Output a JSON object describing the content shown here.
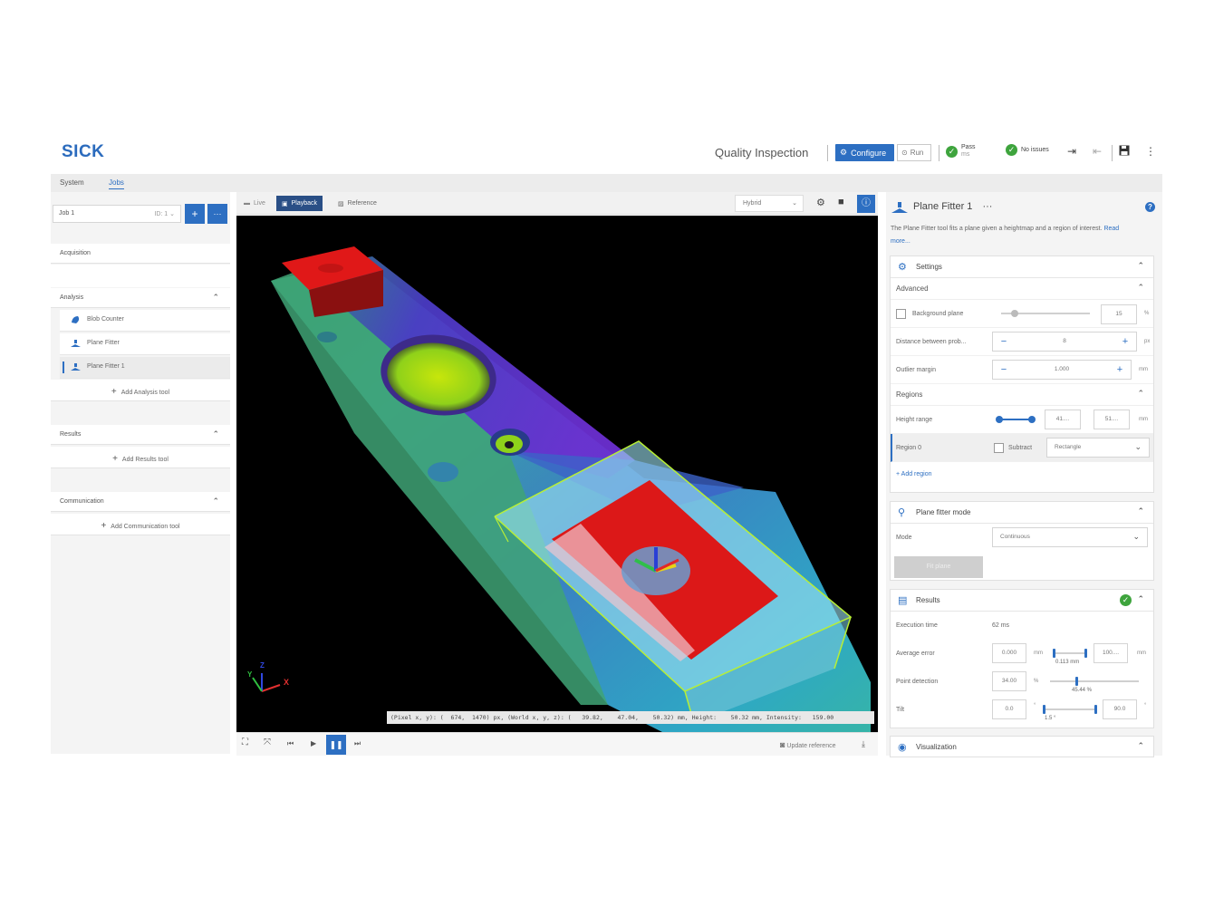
{
  "header": {
    "logo": "SICK",
    "title": "Quality Inspection",
    "configure_label": "Configure",
    "run_label": "Run",
    "pass_label": "Pass",
    "pass_sub": "ms",
    "issues_label": "No issues"
  },
  "nav": {
    "tabs": [
      "System",
      "Jobs"
    ],
    "active": "Jobs"
  },
  "left": {
    "job_value": "Job 1",
    "job_id": "ID: 1",
    "add_label": "+",
    "more_label": "···",
    "sections": {
      "acquisition": "Acquisition",
      "analysis": "Analysis",
      "results": "Results",
      "communication": "Communication"
    },
    "analysis_tools": [
      "Blob Counter",
      "Plane Fitter",
      "Plane Fitter 1"
    ],
    "add_analysis": "Add Analysis tool",
    "add_results": "Add Results tool",
    "add_communication": "Add Communication tool"
  },
  "viewer": {
    "tabs": {
      "live": "Live",
      "playback": "Playback",
      "reference": "Reference"
    },
    "mode_select": "Hybrid",
    "coords": "(Pixel x, y): (  674,  1470) px, (World x, y, z): (   39.82,    47.04,    50.32) mm, Height:    50.32 mm, Intensity:   159.00",
    "axis_x": "X",
    "axis_y": "Y",
    "axis_z": "Z",
    "update_reference": "Update reference"
  },
  "right": {
    "title": "Plane Fitter 1",
    "title_more": "···",
    "description": "The Plane Fitter tool fits a plane given a heightmap and a region of interest.",
    "read_more": "Read more...",
    "settings": {
      "header": "Settings",
      "advanced": "Advanced",
      "background_plane_label": "Background plane",
      "background_plane_value": "15",
      "background_plane_unit": "%",
      "distance_label": "Distance between prob...",
      "distance_value": "8",
      "distance_unit": "px",
      "outlier_label": "Outlier margin",
      "outlier_value": "1.000",
      "outlier_unit": "mm",
      "regions": "Regions",
      "height_range_label": "Height range",
      "height_min": "41....",
      "height_max": "51....",
      "height_unit": "mm",
      "region0_label": "Region 0",
      "subtract_label": "Subtract",
      "region_shape": "Rectangle",
      "add_region": "Add region"
    },
    "mode_card": {
      "header": "Plane fitter mode",
      "mode_label": "Mode",
      "mode_value": "Continuous",
      "fit_plane": "Fit plane"
    },
    "results": {
      "header": "Results",
      "exec_label": "Execution time",
      "exec_value": "62 ms",
      "avg_label": "Average error",
      "avg_min": "0.000",
      "avg_max": "100....",
      "avg_unit": "mm",
      "avg_current": "0.113 mm",
      "point_label": "Point detection",
      "point_min": "34.00",
      "point_unit": "%",
      "point_current": "45.44 %",
      "tilt_label": "Tilt",
      "tilt_min": "0.0",
      "tilt_max": "90.0",
      "tilt_unit": "°",
      "tilt_current": "1.5 °"
    },
    "visualization": {
      "header": "Visualization"
    }
  },
  "colors": {
    "accent": "#2d6fc2",
    "ok": "#3ea43d"
  }
}
